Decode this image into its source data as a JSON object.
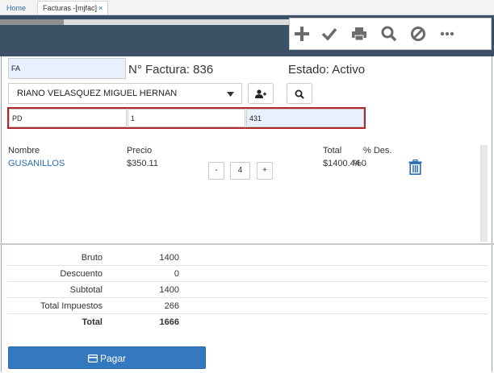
{
  "tabs": {
    "home": "Home",
    "active": "Facturas -[mjfac]",
    "close": "×"
  },
  "progress": {
    "value": 0.22
  },
  "toolbar": {
    "icons": [
      "plus-icon",
      "check-icon",
      "print-icon",
      "search-icon",
      "ban-icon",
      "more-icon"
    ]
  },
  "header": {
    "doc_type": "FA",
    "invoice_label": "N° Factura: 836",
    "status_label": "Estado: Activo"
  },
  "client": {
    "selected": "RIANO VELASQUEZ MIGUEL HERNAN"
  },
  "fields": {
    "f1": "PD",
    "f2": "1",
    "f3": "431"
  },
  "items": {
    "headers": {
      "name": "Nombre",
      "price": "Precio",
      "total": "Total",
      "discount": "% Des."
    },
    "rows": [
      {
        "name": "GUSANILLOS",
        "price": "$350.11",
        "qty": "4",
        "total": "$1400.44",
        "discount": "%0",
        "minus": "-",
        "plus": "+"
      }
    ]
  },
  "totals": [
    {
      "label": "Bruto",
      "value": "1400"
    },
    {
      "label": "Descuento",
      "value": "0"
    },
    {
      "label": "Subtotal",
      "value": "1400"
    },
    {
      "label": "Total Impuestos",
      "value": "266"
    },
    {
      "label": "Total",
      "value": "1666"
    }
  ],
  "pay_button": {
    "label": "Pagar"
  },
  "colors": {
    "header_band": "#3d5166",
    "accent": "#3478c0",
    "link": "#2a6bb0",
    "highlight_border": "#b0282a"
  }
}
